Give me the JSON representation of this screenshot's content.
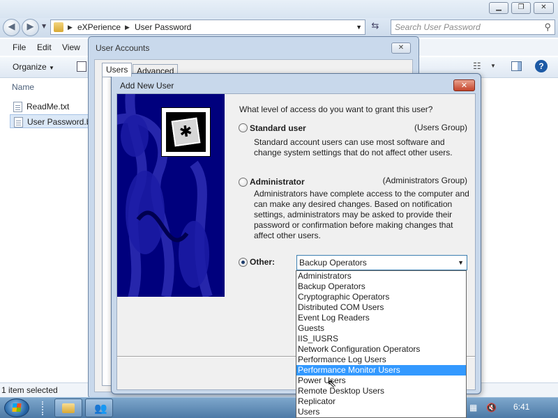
{
  "explorer": {
    "breadcrumb": [
      "eXPerience",
      "User Password"
    ],
    "search_placeholder": "Search User Password",
    "menu": [
      "File",
      "Edit",
      "View"
    ],
    "organize_label": "Organize",
    "column_name": "Name",
    "files": [
      "ReadMe.txt",
      "User Password.b"
    ],
    "status": "1 item selected"
  },
  "user_accounts": {
    "title": "User Accounts",
    "tabs": [
      "Users",
      "Advanced"
    ]
  },
  "add_new_user": {
    "title": "Add New User",
    "question": "What level of access do you want to grant this user?",
    "standard": {
      "label": "Standard user",
      "group": "(Users Group)",
      "description": "Standard account users can use most software and change system settings that do not affect other users."
    },
    "administrator": {
      "label": "Administrator",
      "group": "(Administrators Group)",
      "description": "Administrators have complete access to the computer and can make any desired changes. Based on notification settings, administrators may be asked to provide their password or confirmation before making changes that affect other users."
    },
    "other": {
      "label": "Other:",
      "selected_value": "Backup Operators",
      "options": [
        "Administrators",
        "Backup Operators",
        "Cryptographic Operators",
        "Distributed COM Users",
        "Event Log Readers",
        "Guests",
        "IIS_IUSRS",
        "Network Configuration Operators",
        "Performance Log Users",
        "Performance Monitor Users",
        "Power Users",
        "Remote Desktop Users",
        "Replicator",
        "Users"
      ],
      "highlighted_option": "Performance Monitor Users"
    }
  },
  "taskbar": {
    "clock": "6:41"
  },
  "icons": {
    "start": "windows-logo-icon",
    "explorer": "folder-icon",
    "user_accounts": "users-icon",
    "network": "network-icon",
    "volume": "volume-muted-icon"
  }
}
